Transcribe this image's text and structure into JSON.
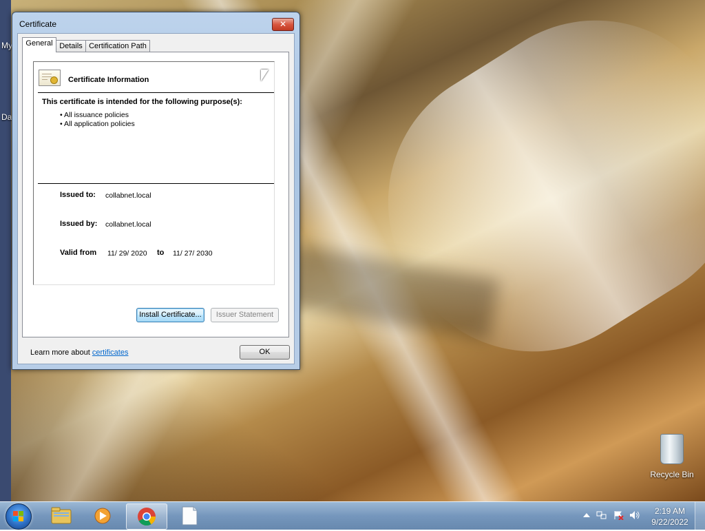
{
  "desktop": {
    "left_labels": [
      "My",
      "Da"
    ],
    "recycle_bin_label": "Recycle Bin"
  },
  "dialog": {
    "title": "Certificate",
    "close_glyph": "✕",
    "tabs": [
      {
        "label": "General",
        "active": true
      },
      {
        "label": "Details",
        "active": false
      },
      {
        "label": "Certification Path",
        "active": false
      }
    ],
    "heading": "Certificate Information",
    "purpose_title": "This certificate is intended for the following purpose(s):",
    "purposes": [
      "• All issuance policies",
      "• All application policies"
    ],
    "issued_to_label": "Issued to:",
    "issued_to_value": "collabnet.local",
    "issued_by_label": "Issued by:",
    "issued_by_value": "collabnet.local",
    "valid_from_label": "Valid from",
    "valid_from_value": "11/ 29/ 2020",
    "valid_to_label": "to",
    "valid_to_value": "11/ 27/ 2030",
    "install_button": "Install Certificate...",
    "issuer_statement_button": "Issuer Statement",
    "learn_more_text": "Learn more about",
    "learn_more_link": "certificates",
    "ok_button": "OK"
  },
  "taskbar": {
    "pinned": [
      {
        "name": "windows-explorer",
        "icon": "folder-icon"
      },
      {
        "name": "media-player",
        "icon": "media-player-icon"
      },
      {
        "name": "google-chrome",
        "icon": "chrome-icon",
        "active": true
      },
      {
        "name": "document",
        "icon": "document-icon"
      }
    ],
    "tray": [
      "show-hidden-icons",
      "network-icon",
      "action-center-icon",
      "volume-icon"
    ],
    "time": "2:19 AM",
    "date": "9/22/2022"
  },
  "colors": {
    "link": "#0066cc",
    "close_button": "#c13a22",
    "window_frame": "#a9c4e2"
  }
}
